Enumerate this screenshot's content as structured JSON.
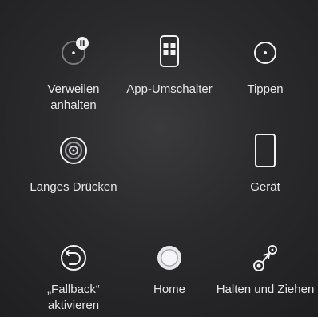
{
  "menu": {
    "dwell_pause": {
      "line1": "Verweilen",
      "line2": "anhalten",
      "icon": "dwell-pause-icon"
    },
    "app_switcher": {
      "label": "App-Umschalter",
      "icon": "app-switcher-icon"
    },
    "tap": {
      "label": "Tippen",
      "icon": "tap-icon"
    },
    "long_press": {
      "label": "Langes Drücken",
      "icon": "long-press-icon"
    },
    "device": {
      "label": "Gerät",
      "icon": "device-icon"
    },
    "fallback": {
      "line1": "„Fallback“",
      "line2": "aktivieren",
      "icon": "fallback-icon"
    },
    "home": {
      "label": "Home",
      "icon": "home-icon"
    },
    "hold_drag": {
      "label": "Halten und Ziehen",
      "icon": "hold-drag-icon"
    }
  },
  "colors": {
    "background": "#2a2a2d",
    "text": "#e6e6e8",
    "icon": "#f2f2f4"
  }
}
